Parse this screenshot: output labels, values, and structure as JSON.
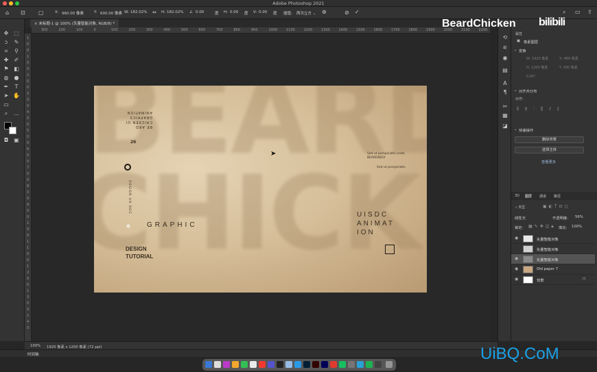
{
  "window": {
    "title": "Adobe Photoshop 2021"
  },
  "options_bar": {
    "x_label": "X:",
    "x_value": "960.00 像素",
    "y_label": "Y:",
    "y_value": "600.00 像素",
    "w_label": "W:",
    "w_value": "182.02%",
    "h_label": "H:",
    "h_value": "182.02%",
    "angle_value": "0.00",
    "angle_unit": "度",
    "hskew_label": "H:",
    "hskew_value": "0.00",
    "hskew_unit": "度",
    "vskew_label": "V:",
    "vskew_value": "0.00",
    "vskew_unit": "度",
    "interp_label": "插值:",
    "interp_value": "两次立方 ⌄"
  },
  "document": {
    "tab_label": "未标题-1 @ 100% (矢量智能对象, RGB/8) *",
    "zoom": "100%",
    "size_info": "1920 像素 x 1200 像素 (72 ppi)"
  },
  "ruler_h_ticks": [
    "300",
    "200",
    "100",
    "0",
    "100",
    "200",
    "300",
    "400",
    "500",
    "600",
    "700",
    "800",
    "900",
    "1000",
    "1100",
    "1200",
    "1300",
    "1400",
    "1500",
    "1600",
    "1700",
    "1800",
    "1900",
    "2000",
    "2100",
    "2200"
  ],
  "ruler_v_ticks": [
    "1",
    "0",
    "0",
    "1",
    "0",
    "0",
    "2",
    "0",
    "0",
    "3",
    "0",
    "0",
    "4",
    "0",
    "0",
    "5",
    "0",
    "0",
    "6",
    "0",
    "0",
    "7",
    "0",
    "0",
    "8",
    "0",
    "0",
    "9",
    "0",
    "0",
    "1",
    "0",
    "0",
    "1",
    "1",
    "0",
    "0",
    "1",
    "2",
    "0",
    "0",
    "1",
    "3",
    "0",
    "0",
    "1",
    "4",
    "0"
  ],
  "artwork": {
    "big1": "BEARD",
    "big2": "CHICKEN",
    "rot_lines": [
      "BE ARD",
      "CHICKEN UI",
      "GRAPHICS",
      "ANIMATION"
    ],
    "num": "26",
    "rot2": "DESIGN UX DOC",
    "graphic": "GRAPHIC",
    "design": "DESIGN",
    "tutorial": "TUTORIAL",
    "small1": "Sed ut perspiciatis unde",
    "small2": "BEARDIDEA",
    "small3": "Sed ut perspiciatis",
    "uisdc": "UISDC",
    "animat": "ANIMAT",
    "ion": "ION"
  },
  "timeline": {
    "label": "时间轴"
  },
  "panel": {
    "props_tab": "属性",
    "props_obj": "像素图层",
    "transform_title": "变换",
    "tw": "W: 1920 像素",
    "tx": "X: 480 像素",
    "th": "H: 1200 像素",
    "ty": "Y: 300 像素",
    "tangle": "0.00°",
    "align_title": "对齐并分布",
    "align_sub": "对齐:",
    "quick_title": "快速操作",
    "btn_remove_bg": "删除背景",
    "btn_select_subject": "选择主体",
    "more_link": "查看更多",
    "layers_tabs": [
      "3D",
      "图层",
      "通道",
      "路径"
    ],
    "kind_label": "类型",
    "blend_mode": "线性光",
    "opacity_label": "不透明度:",
    "opacity_value": "56%",
    "lock_label": "锁定:",
    "fill_label": "填充:",
    "fill_value": "100%",
    "layers": [
      {
        "name": "矢量智能对象",
        "visible": true
      },
      {
        "name": "矢量智能对象",
        "visible": false
      },
      {
        "name": "矢量智能对象",
        "visible": true
      },
      {
        "name": "Old paper 7",
        "visible": true
      },
      {
        "name": "背景",
        "visible": true
      }
    ]
  },
  "watermark": {
    "top": "BeardChicken",
    "bili": "bilibili",
    "bottom": "UiBQ.CoM"
  },
  "colors": {
    "accent_blue": "#1aa0e6",
    "paper": "#d8c2a0",
    "panel_bg": "#333333",
    "canvas_bg": "#282828"
  }
}
